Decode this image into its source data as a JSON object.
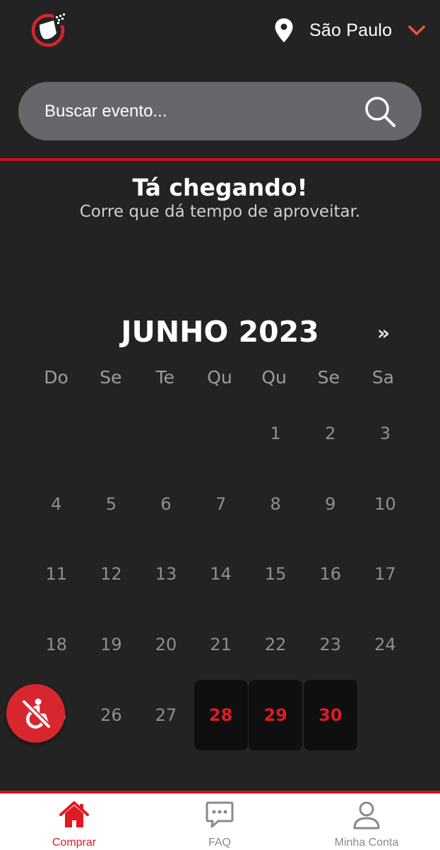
{
  "header": {
    "logo_icon": "guitar-ticket-logo-icon",
    "location_icon": "location-pin-icon",
    "city": "São Paulo",
    "dropdown_icon": "chevron-down-icon"
  },
  "search": {
    "placeholder": "Buscar evento...",
    "icon": "search-icon"
  },
  "promo": {
    "title": "Tá chegando!",
    "subtitle": "Corre que dá tempo de aproveitar."
  },
  "calendar": {
    "month": "JUNHO 2023",
    "next_label": "»",
    "weekdays": [
      "Do",
      "Se",
      "Te",
      "Qu",
      "Qu",
      "Se",
      "Sa"
    ],
    "weeks": [
      [
        "",
        "",
        "",
        "",
        "1",
        "2",
        "3"
      ],
      [
        "4",
        "5",
        "6",
        "7",
        "8",
        "9",
        "10"
      ],
      [
        "11",
        "12",
        "13",
        "14",
        "15",
        "16",
        "17"
      ],
      [
        "18",
        "19",
        "20",
        "21",
        "22",
        "23",
        "24"
      ],
      [
        "25",
        "26",
        "27",
        "28",
        "29",
        "30",
        ""
      ]
    ],
    "available_days": [
      "28",
      "29",
      "30"
    ]
  },
  "accessibility": {
    "icon": "accessibility-icon"
  },
  "bottom_nav": {
    "items": [
      {
        "label": "Comprar",
        "icon": "home-icon",
        "active": true
      },
      {
        "label": "FAQ",
        "icon": "chat-bubble-icon",
        "active": false
      },
      {
        "label": "Minha Conta",
        "icon": "user-icon",
        "active": false
      }
    ]
  },
  "colors": {
    "accent": "#e01a24",
    "background": "#232323",
    "search_bg": "#67666b",
    "nav_active": "#e01a24",
    "nav_inactive": "#8a8a8a"
  }
}
